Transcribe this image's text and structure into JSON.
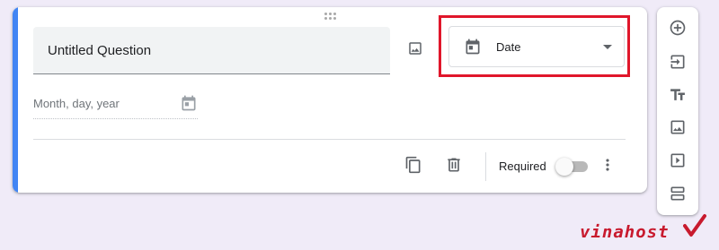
{
  "question": {
    "title": "Untitled Question",
    "type_label": "Date",
    "date_placeholder": "Month, day, year"
  },
  "footer": {
    "required_label": "Required",
    "required_on": false
  },
  "toolbar": {
    "items": [
      "add-question",
      "import-questions",
      "add-title",
      "add-image",
      "add-video",
      "add-section"
    ]
  },
  "watermark": {
    "brand": "vinahost"
  },
  "colors": {
    "accent": "#4285f4",
    "highlight": "#e0162b",
    "background": "#f0ebf8",
    "watermark": "#c81a2e"
  }
}
